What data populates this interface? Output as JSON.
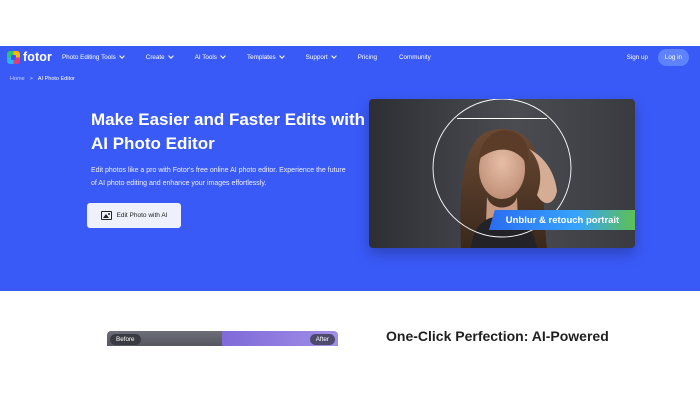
{
  "brand": {
    "logo_text": "fotor",
    "accent": "#3a5af8"
  },
  "nav": {
    "items": [
      {
        "label": "Photo Editing Tools",
        "dropdown": true
      },
      {
        "label": "Create",
        "dropdown": true
      },
      {
        "label": "AI Tools",
        "dropdown": true
      },
      {
        "label": "Templates",
        "dropdown": true
      },
      {
        "label": "Support",
        "dropdown": true
      },
      {
        "label": "Pricing",
        "dropdown": false
      },
      {
        "label": "Community",
        "dropdown": false
      }
    ],
    "signup_label": "Sign up",
    "login_label": "Log in"
  },
  "breadcrumb": {
    "home": "Home",
    "separator": ">",
    "current": "AI Photo Editor"
  },
  "hero": {
    "headline": "Make Easier and Faster Edits with AI Photo Editor",
    "description": "Edit photos like a pro with Fotor's free online AI photo editor. Experience the future of AI photo editing and enhance your images effortlessly.",
    "cta_label": "Edit Photo with AI",
    "cta_icon": "image-edit-icon",
    "card_ribbon": "Unblur & retouch portrait"
  },
  "compare": {
    "before_label": "Before",
    "after_label": "After",
    "heading": "One-Click Perfection: AI-Powered"
  }
}
